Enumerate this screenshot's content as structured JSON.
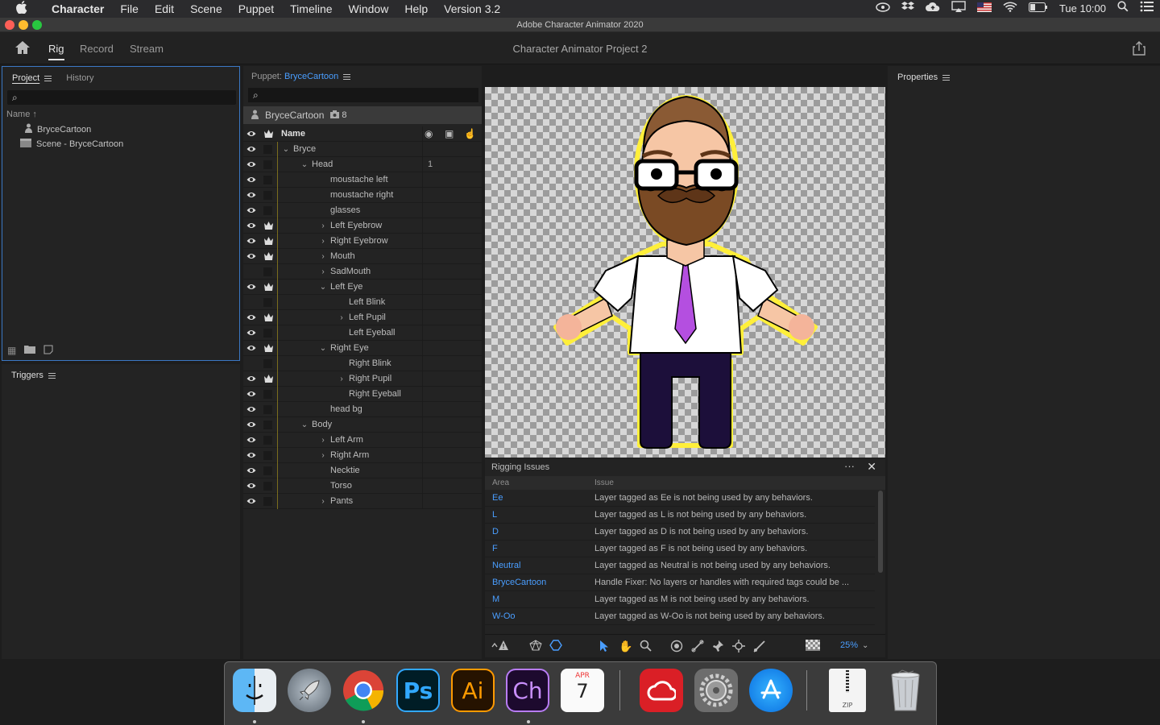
{
  "menubar": {
    "app": "Character",
    "items": [
      "File",
      "Edit",
      "Scene",
      "Puppet",
      "Timeline",
      "Window",
      "Help",
      "Version 3.2"
    ],
    "clock": "Tue 10:00"
  },
  "window": {
    "title": "Adobe Character Animator 2020"
  },
  "header": {
    "tabs": [
      "Rig",
      "Record",
      "Stream"
    ],
    "active_tab": "Rig",
    "project_name": "Character Animator Project 2"
  },
  "project_panel": {
    "tabs": [
      "Project",
      "History"
    ],
    "name_column": "Name",
    "items": [
      "BryceCartoon",
      "Scene - BryceCartoon"
    ]
  },
  "triggers_panel": {
    "title": "Triggers"
  },
  "puppet_panel": {
    "label": "Puppet:",
    "puppet_name": "BryceCartoon",
    "header_name": "BryceCartoon",
    "header_count": "8",
    "layers": [
      {
        "name": "Name",
        "depth": 0,
        "chev": "",
        "eye": true,
        "crown": true,
        "header": true
      },
      {
        "name": "Bryce",
        "depth": 1,
        "chev": "v",
        "eye": true,
        "crown": false
      },
      {
        "name": "Head",
        "depth": 2,
        "chev": "v",
        "eye": true,
        "crown": false,
        "num": "1"
      },
      {
        "name": "moustache left",
        "depth": 3,
        "chev": "",
        "eye": true,
        "crown": false
      },
      {
        "name": "moustache right",
        "depth": 3,
        "chev": "",
        "eye": true,
        "crown": false
      },
      {
        "name": "glasses",
        "depth": 3,
        "chev": "",
        "eye": true,
        "crown": false
      },
      {
        "name": "Left Eyebrow",
        "depth": 3,
        "chev": ">",
        "eye": true,
        "crown": true
      },
      {
        "name": "Right Eyebrow",
        "depth": 3,
        "chev": ">",
        "eye": true,
        "crown": true
      },
      {
        "name": "Mouth",
        "depth": 3,
        "chev": ">",
        "eye": true,
        "crown": true
      },
      {
        "name": "SadMouth",
        "depth": 3,
        "chev": ">",
        "eye": false,
        "crown": false
      },
      {
        "name": "Left Eye",
        "depth": 3,
        "chev": "v",
        "eye": true,
        "crown": true
      },
      {
        "name": "Left Blink",
        "depth": 4,
        "chev": "",
        "eye": false,
        "crown": false
      },
      {
        "name": "Left Pupil",
        "depth": 4,
        "chev": ">",
        "eye": true,
        "crown": true
      },
      {
        "name": "Left Eyeball",
        "depth": 4,
        "chev": "",
        "eye": true,
        "crown": false
      },
      {
        "name": "Right Eye",
        "depth": 3,
        "chev": "v",
        "eye": true,
        "crown": true
      },
      {
        "name": "Right Blink",
        "depth": 4,
        "chev": "",
        "eye": false,
        "crown": false
      },
      {
        "name": "Right Pupil",
        "depth": 4,
        "chev": ">",
        "eye": true,
        "crown": true
      },
      {
        "name": "Right Eyeball",
        "depth": 4,
        "chev": "",
        "eye": true,
        "crown": false
      },
      {
        "name": "head bg",
        "depth": 3,
        "chev": "",
        "eye": true,
        "crown": false
      },
      {
        "name": "Body",
        "depth": 2,
        "chev": "v",
        "eye": true,
        "crown": false
      },
      {
        "name": "Left Arm",
        "depth": 3,
        "chev": ">",
        "eye": true,
        "crown": false
      },
      {
        "name": "Right Arm",
        "depth": 3,
        "chev": ">",
        "eye": true,
        "crown": false
      },
      {
        "name": "Necktie",
        "depth": 3,
        "chev": "",
        "eye": true,
        "crown": false
      },
      {
        "name": "Torso",
        "depth": 3,
        "chev": "",
        "eye": true,
        "crown": false
      },
      {
        "name": "Pants",
        "depth": 3,
        "chev": ">",
        "eye": true,
        "crown": false
      }
    ]
  },
  "rigging": {
    "title": "Rigging Issues",
    "col_area": "Area",
    "col_issue": "Issue",
    "rows": [
      {
        "area": "Ee",
        "issue": "Layer tagged as Ee is not being used by any behaviors."
      },
      {
        "area": "L",
        "issue": "Layer tagged as L is not being used by any behaviors."
      },
      {
        "area": "D",
        "issue": "Layer tagged as D is not being used by any behaviors."
      },
      {
        "area": "F",
        "issue": "Layer tagged as F is not being used by any behaviors."
      },
      {
        "area": "Neutral",
        "issue": "Layer tagged as Neutral is not being used by any behaviors."
      },
      {
        "area": "BryceCartoon",
        "issue": "Handle Fixer: No layers or handles with required tags could be ..."
      },
      {
        "area": "M",
        "issue": "Layer tagged as M is not being used by any behaviors."
      },
      {
        "area": "W-Oo",
        "issue": "Layer tagged as W-Oo is not being used by any behaviors."
      }
    ]
  },
  "toolbar": {
    "zoom": "25%"
  },
  "properties_panel": {
    "title": "Properties"
  },
  "dock": {
    "calendar_month": "APR",
    "calendar_day": "7",
    "apps": [
      "Finder",
      "Launchpad",
      "Chrome",
      "Ps",
      "Ai",
      "Ch",
      "Calendar",
      "Creative Cloud",
      "System Preferences",
      "App Store",
      "ZIP",
      "Trash"
    ]
  },
  "colors": {
    "accent": "#4a9eff",
    "selection_border": "#3b78c4"
  }
}
